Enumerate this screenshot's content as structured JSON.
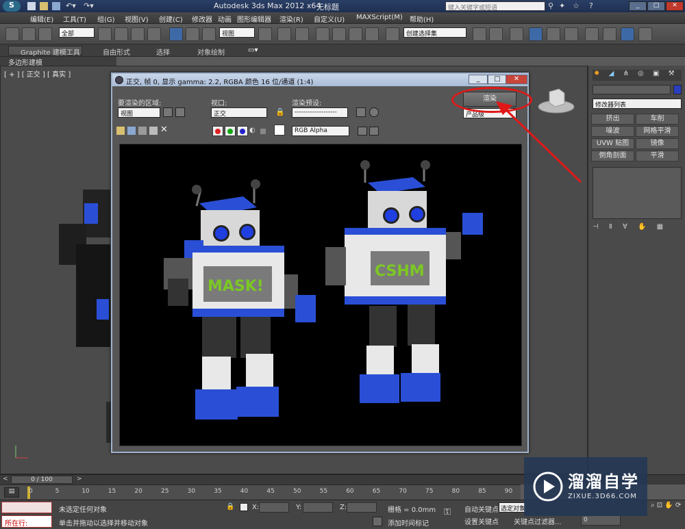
{
  "window": {
    "app_title": "Autodesk 3ds Max  2012 x64",
    "doc_title": "无标题",
    "search_placeholder": "键入关键字或短语"
  },
  "menu": [
    "编辑(E)",
    "工具(T)",
    "组(G)",
    "视图(V)",
    "创建(C)",
    "修改器",
    "动画",
    "图形编辑器",
    "渲染(R)",
    "自定义(U)",
    "MAXScript(M)",
    "帮助(H)"
  ],
  "toolbar": {
    "selection_filter": "全部",
    "ref_coord": "视图",
    "named_selection": "创建选择集"
  },
  "ribbon": {
    "tabs": [
      "Graphite 建模工具",
      "自由形式",
      "选择",
      "对象绘制"
    ],
    "subtab": "多边形建模"
  },
  "viewport": {
    "label": "[ + ] [ 正交 ] [ 真实 ]"
  },
  "render_window": {
    "title": "正交, 帧 0, 显示 gamma: 2.2, RGBA 颜色 16 位/通道 (1:4)",
    "area_label": "要渲染的区域:",
    "area_value": "视图",
    "viewport_label": "视口:",
    "viewport_value": "正交",
    "preset_label": "渲染预设:",
    "preset_value": "-------------------",
    "render_button": "渲染",
    "quality_value": "产品级",
    "channel_value": "RGB Alpha",
    "minimize": "_",
    "maximize": "□",
    "close": "✕"
  },
  "robots": {
    "left_text": "MASK!",
    "right_text": "CSHM"
  },
  "command_panel": {
    "modifier_list": "修改器列表",
    "buttons": [
      "挤出",
      "车削",
      "噪波",
      "网格平滑",
      "UVW 贴图",
      "镜像",
      "倒角剖面",
      "平滑"
    ]
  },
  "timeline": {
    "frame_counter": "0 / 100",
    "ticks": [
      "0",
      "5",
      "10",
      "15",
      "20",
      "25",
      "30",
      "35",
      "40",
      "45",
      "50",
      "55",
      "60",
      "65",
      "70",
      "75",
      "80",
      "85",
      "90"
    ]
  },
  "status": {
    "running_label": "所在行:",
    "selection_status": "未选定任何对象",
    "prompt": "单击并拖动以选择并移动对象",
    "x_label": "X:",
    "y_label": "Y:",
    "z_label": "Z:",
    "grid": "栅格 = 0.0mm",
    "add_time_tag": "添加时间标记",
    "auto_key": "自动关键点",
    "set_key": "设置关键点",
    "selected_object": "选定对象",
    "key_filters": "关键点过滤器...",
    "frame_value": "0"
  },
  "watermark": {
    "brand": "溜溜自学",
    "url": "ZIXUE.3D66.COM"
  },
  "colors": {
    "robot_blue": "#2a4fd6",
    "robot_white": "#e8e8e8",
    "robot_green": "#7cc823",
    "annotation_red": "#e01818"
  }
}
